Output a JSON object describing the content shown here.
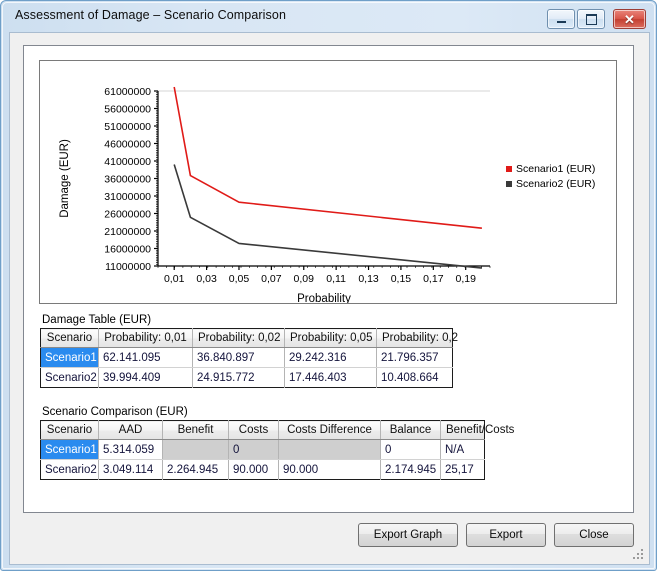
{
  "window": {
    "title": "Assessment of Damage – Scenario Comparison",
    "minimize_label": "Minimize",
    "maximize_label": "Maximize",
    "close_label": "✕"
  },
  "sections": {
    "damage_table_label": "Damage Table (EUR)",
    "comparison_table_label": "Scenario Comparison (EUR)"
  },
  "chart_data": {
    "type": "line",
    "title": "",
    "xlabel": "Probability",
    "ylabel": "Damage (EUR)",
    "x": [
      0.01,
      0.02,
      0.05,
      0.2
    ],
    "xlim": [
      0.0,
      0.205
    ],
    "ylim": [
      11000000,
      61000000
    ],
    "xticks": [
      "0,01",
      "0,03",
      "0,05",
      "0,07",
      "0,09",
      "0,11",
      "0,13",
      "0,15",
      "0,17",
      "0,19"
    ],
    "xtick_values": [
      0.01,
      0.03,
      0.05,
      0.07,
      0.09,
      0.11,
      0.13,
      0.15,
      0.17,
      0.19
    ],
    "yticks": [
      "11000000",
      "16000000",
      "21000000",
      "26000000",
      "31000000",
      "36000000",
      "41000000",
      "46000000",
      "51000000",
      "56000000",
      "61000000"
    ],
    "ytick_values": [
      11000000,
      16000000,
      21000000,
      26000000,
      31000000,
      36000000,
      41000000,
      46000000,
      51000000,
      56000000,
      61000000
    ],
    "grid": false,
    "legend_position": "right",
    "series": [
      {
        "name": "Scenario1 (EUR)",
        "color": "#e01b18",
        "values": [
          62141095,
          36840897,
          29242316,
          21796357
        ]
      },
      {
        "name": "Scenario2 (EUR)",
        "color": "#3a3a3a",
        "values": [
          39994409,
          24915772,
          17446403,
          10408664
        ]
      }
    ]
  },
  "damage_table": {
    "columns": [
      "Scenario",
      "Probability: 0,01",
      "Probability: 0,02",
      "Probability: 0,05",
      "Probability: 0,2"
    ],
    "rows": [
      {
        "scenario": "Scenario1",
        "selected": true,
        "cells": [
          "62.141.095",
          "36.840.897",
          "29.242.316",
          "21.796.357"
        ]
      },
      {
        "scenario": "Scenario2",
        "selected": false,
        "cells": [
          "39.994.409",
          "24.915.772",
          "17.446.403",
          "10.408.664"
        ]
      }
    ]
  },
  "comparison_table": {
    "columns": [
      "Scenario",
      "AAD",
      "Benefit",
      "Costs",
      "Costs Difference",
      "Balance",
      "Benefit/Costs"
    ],
    "rows": [
      {
        "scenario": "Scenario1",
        "selected": true,
        "aad": "5.314.059",
        "benefit": "",
        "costs": "0",
        "costs_difference": "",
        "balance": "0",
        "benefit_costs": "N/A"
      },
      {
        "scenario": "Scenario2",
        "selected": false,
        "aad": "3.049.114",
        "benefit": "2.264.945",
        "costs": "90.000",
        "costs_difference": "90.000",
        "balance": "2.174.945",
        "benefit_costs": "25,17"
      }
    ]
  },
  "footer": {
    "export_graph_label": "Export Graph",
    "export_label": "Export",
    "close_label": "Close"
  }
}
